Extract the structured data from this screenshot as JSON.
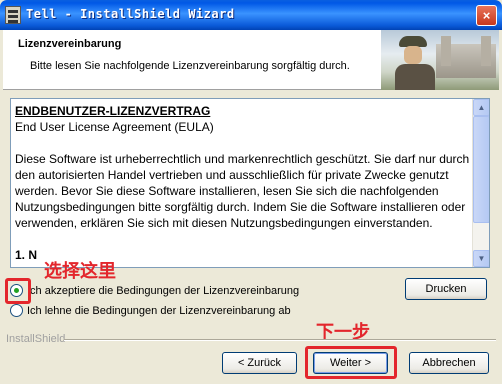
{
  "window": {
    "title": "Tell - InstallShield Wizard",
    "close_glyph": "×"
  },
  "header": {
    "title": "Lizenzvereinbarung",
    "subtitle": "Bitte lesen Sie nachfolgende Lizenzvereinbarung sorgfältig durch."
  },
  "license": {
    "heading": "ENDBENUTZER-LIZENZVERTRAG",
    "subheading": "End User License Agreement (EULA)",
    "body": "Diese Software ist urheberrechtlich und markenrechtlich geschützt. Sie darf nur durch den autorisierten Handel vertrieben und ausschließlich für private Zwecke genutzt werden. Bevor Sie diese Software installieren, lesen Sie sich die nachfolgenden Nutzungsbedingungen bitte sorgfältig durch. Indem Sie die Software installieren oder verwenden, erklären Sie sich mit diesen Nutzungsbedingungen einverstanden.",
    "partial_line": "1. N",
    "scroll_up": "▲",
    "scroll_down": "▼"
  },
  "options": {
    "accept": "Ich akzeptiere die Bedingungen der Lizenzvereinbarung",
    "decline": "Ich lehne die Bedingungen der Lizenzvereinbarung ab",
    "accept_checked": true
  },
  "annotations": {
    "select_here": "选择这里",
    "next_step": "下一步",
    "color": "#e3262c"
  },
  "buttons": {
    "print": "Drucken",
    "back": "< Zurück",
    "next": "Weiter >",
    "cancel": "Abbrechen"
  },
  "footer": {
    "brand": "InstallShield"
  }
}
